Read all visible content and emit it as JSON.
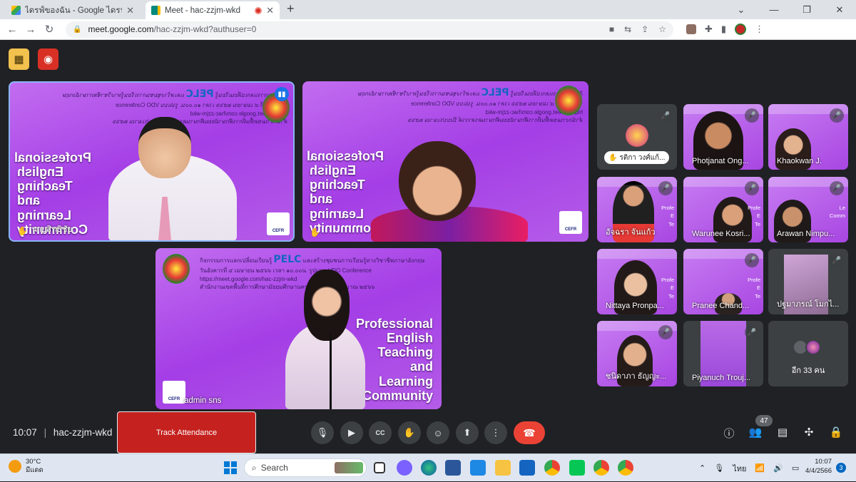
{
  "browser": {
    "tabs": [
      {
        "title": "ไดรฟ์ของฉัน - Google ไดรฟ์",
        "active": false
      },
      {
        "title": "Meet - hac-zzjm-wkd",
        "active": true
      }
    ],
    "new_tab": "+",
    "url_host": "meet.google.com",
    "url_path": "/hac-zzjm-wkd?authuser=0"
  },
  "meet": {
    "main_tiles": [
      {
        "name": "นายสิทธิชัย",
        "banner_line1": "กิจกรรมการแลกเปลี่ยนเรียนรู้",
        "pelc": "PELC",
        "banner_line1b": "และสร้างชุมชนการเรียนรู้ทางวิชาชีพภาษาอังกฤษ",
        "banner_line2": "วันอังคารที่ ๔ เมษายน ๒๕๖๖ เวลา ๑๐.๐๐น. รูปแบบ VDO Conference https://meet.google.com/hac-zzjm-wkd",
        "banner_line3": "สำนักงานเขตพื้นที่การศึกษามัธยมศึกษานครสวรรค์ ปีงบประมาณ ๒๕๖๖",
        "pro_lines": [
          "Professional",
          "English",
          "Teaching",
          "and",
          "Learning",
          "Community"
        ],
        "cefr": "CEFR"
      },
      {
        "name": "",
        "banner_line1": "กิจกรรมการแลกเปลี่ยนเรียนรู้",
        "pelc": "PELC",
        "banner_line1b": "และสร้างชุมชนการเรียนรู้ทางวิชาชีพภาษาอังกฤษ",
        "banner_line2": "วันอังคารที่ ๔ เมษายน ๒๕๖๖ เวลา ๑๐.๐๐น. รูปแบบ VDO Conference https://meet.google.com/hac-zzjm-wkd",
        "banner_line3": "สำนักงานเขตพื้นที่การศึกษามัธยมศึกษานครสวรรค์ ปีงบประมาณ ๒๕๖๖",
        "pro_lines": [
          "Professional",
          "English",
          "Teaching",
          "and",
          "Learning",
          "Community"
        ],
        "cefr": "CEFR"
      },
      {
        "name": "admin sns",
        "banner_line1": "กิจกรรมการแลกเปลี่ยนเรียนรู้",
        "pelc": "PELC",
        "banner_line1b": "และสร้างชุมชนการเรียนรู้ทางวิชาชีพภาษาอังกฤษ",
        "banner_line2": "วันอังคารที่ ๔ เมษายน ๒๕๖๖ เวลา ๑๐.๐๐น. รูปแบบ VDO Conference https://meet.google.com/hac-zzjm-wkd",
        "banner_line3": "สำนักงานเขตพื้นที่การศึกษามัธยมศึกษานครสวรรค์ ปีงบประมาณ ๒๕๖๖",
        "pro_lines": [
          "Professional",
          "English",
          "Teaching",
          "and",
          "Learning",
          "Community"
        ],
        "cefr": "CEFR"
      }
    ],
    "participants": [
      {
        "name": "รติกา วงศ์แก้..."
      },
      {
        "name": "Photjanat Ong..."
      },
      {
        "name": "Khaokwan J."
      },
      {
        "name": "อัจฉรา จันแก้ว"
      },
      {
        "name": "Warunee Kosri..."
      },
      {
        "name": "Arawan Nimpu..."
      },
      {
        "name": "Nittaya Pronpa..."
      },
      {
        "name": "Pranee Chand..."
      },
      {
        "name": "ปฐมาภรณ์ โมกไ..."
      },
      {
        "name": "ชนิดาภา ธัญญะ..."
      },
      {
        "name": "Piyanuch Trouj..."
      }
    ],
    "more_label": "อีก 33 คน",
    "side_text": [
      "Profe",
      "E",
      "Te",
      "Le",
      "Comm"
    ],
    "clock": "10:07",
    "meeting_code": "hac-zzjm-wkd",
    "track_attendance": "Track Attendance",
    "people_count": "47"
  },
  "taskbar": {
    "weather_temp": "30°C",
    "weather_desc": "มีแดด",
    "search": "Search",
    "lang": "ไทย",
    "time": "10:07",
    "date": "4/4/2566",
    "notif_count": "3"
  },
  "colors": {
    "accent_blue": "#8ab4f8",
    "end_call": "#ea4335",
    "track_button": "#c5221f",
    "tile_purple": "#b04fe8"
  }
}
